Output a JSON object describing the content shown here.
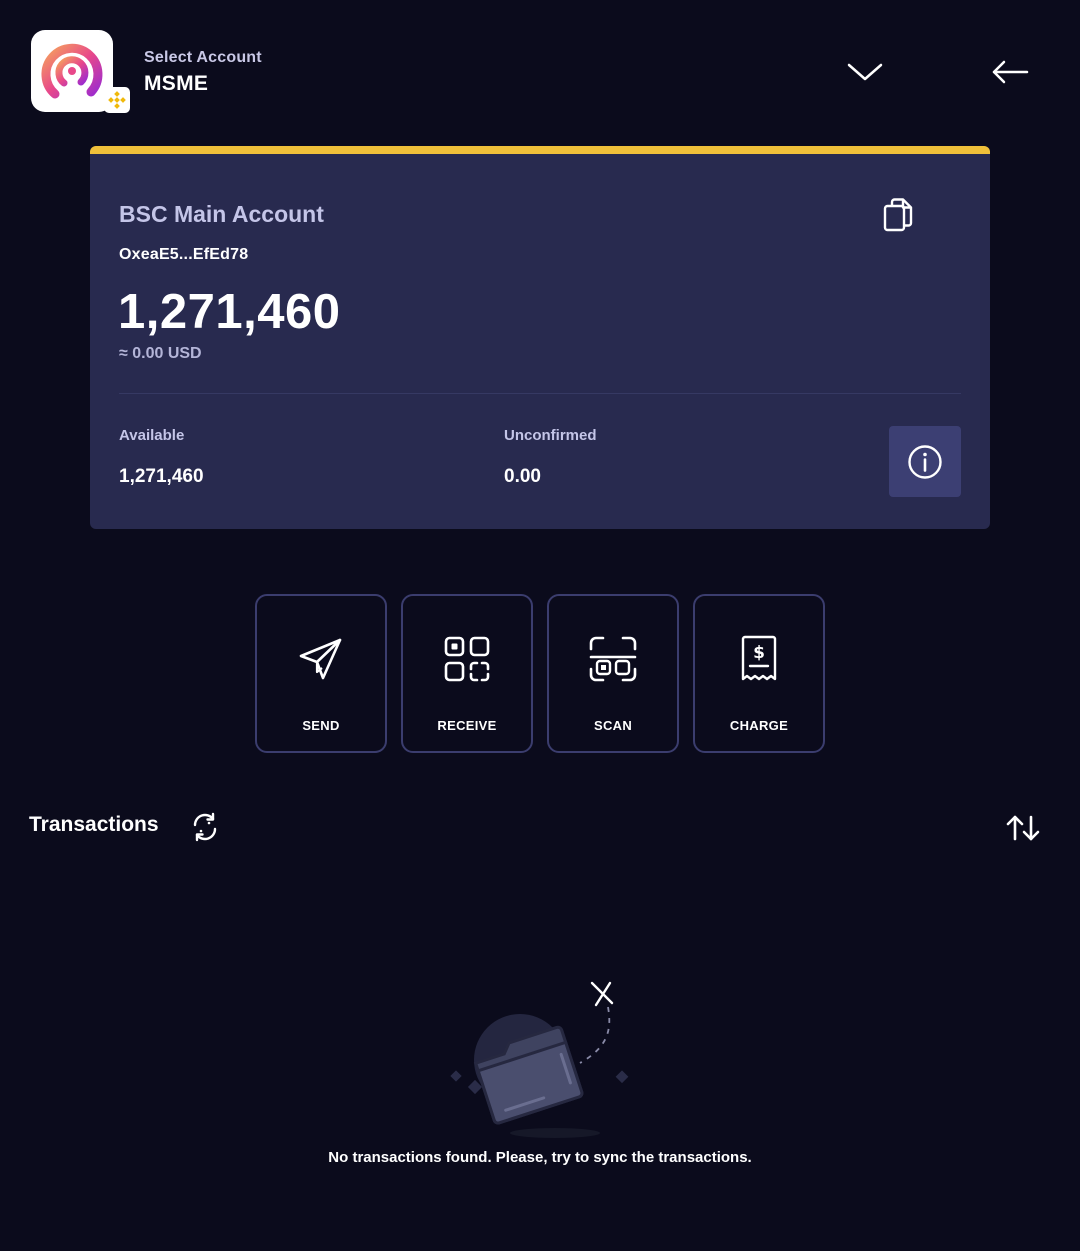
{
  "header": {
    "account_label": "Select Account",
    "account_name": "MSME"
  },
  "card": {
    "title": "BSC Main Account",
    "address": "OxeaE5...EfEd78",
    "balance": "1,271,460",
    "fiat": "≈ 0.00 USD",
    "available_label": "Available",
    "available_value": "1,271,460",
    "unconfirmed_label": "Unconfirmed",
    "unconfirmed_value": "0.00"
  },
  "actions": [
    {
      "label": "SEND",
      "icon": "paper-plane-icon"
    },
    {
      "label": "RECEIVE",
      "icon": "qr-code-icon"
    },
    {
      "label": "SCAN",
      "icon": "scan-icon"
    },
    {
      "label": "CHARGE",
      "icon": "receipt-dollar-icon"
    }
  ],
  "transactions": {
    "title": "Transactions",
    "empty_message": "No transactions found. Please, try to sync the transactions."
  },
  "colors": {
    "background": "#0b0b1c",
    "card": "#282a4f",
    "accent_bar": "#f0c03a",
    "button_border": "#3b3d6e",
    "info_button": "#3c3f73"
  }
}
